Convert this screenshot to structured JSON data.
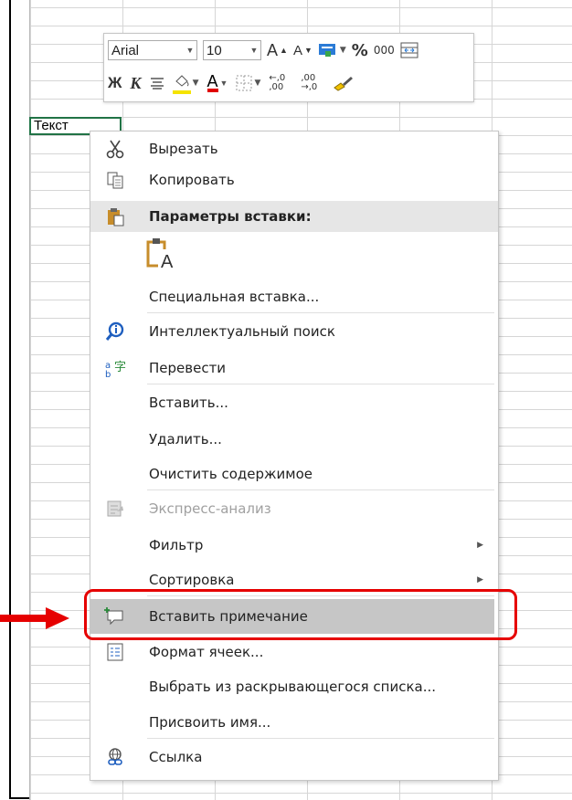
{
  "cell": {
    "value": "Текст"
  },
  "minibar": {
    "font": "Arial",
    "size": "10",
    "grow_font": "A",
    "shrink_font": "A",
    "percent": "%",
    "thousands": "000",
    "bold": "Ж",
    "italic": "К",
    "font_color": "А",
    "increase_decimal": "←,0 ,00",
    "decrease_decimal": ",00 →,0"
  },
  "menu": {
    "cut": "Вырезать",
    "copy": "Копировать",
    "paste_options": "Параметры вставки:",
    "paste_special": "Специальная вставка...",
    "smart_lookup": "Интеллектуальный поиск",
    "translate": "Перевести",
    "insert": "Вставить...",
    "delete": "Удалить...",
    "clear_contents": "Очистить содержимое",
    "quick_analysis": "Экспресс-анализ",
    "filter": "Фильтр",
    "sort": "Сортировка",
    "insert_comment": "Вставить примечание",
    "format_cells": "Формат ячеек...",
    "pick_from_list": "Выбрать из раскрывающегося списка...",
    "define_name": "Присвоить имя...",
    "link": "Ссылка"
  },
  "colors": {
    "highlight_box": "#e60000",
    "selection": "#217346",
    "fill_color": "#f5e300",
    "font_color": "#e00000"
  }
}
